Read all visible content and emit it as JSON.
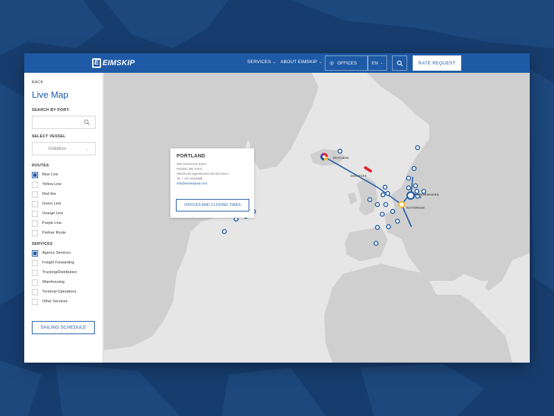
{
  "header": {
    "logo_text": "EIMSKIP",
    "logo_mark": "E",
    "nav": [
      {
        "label": "SERVICES"
      },
      {
        "label": "ABOUT EIMSKIP"
      }
    ],
    "offices_label": "OFFICES",
    "language": "EN",
    "rate_request_label": "RATE REQUEST"
  },
  "sidebar": {
    "back_label": "BACK",
    "title": "Live Map",
    "search_port_label": "SEARCH BY PORT:",
    "search_port_value": "",
    "select_vessel_label": "SELECT VESSEL",
    "selected_vessel": "Godafoss",
    "routes_label": "ROUTES",
    "routes": [
      {
        "label": "Blue Line",
        "checked": true
      },
      {
        "label": "Yellow Line",
        "checked": false
      },
      {
        "label": "Red line",
        "checked": false
      },
      {
        "label": "Green Line",
        "checked": false
      },
      {
        "label": "Orange Line",
        "checked": false
      },
      {
        "label": "Purple Line",
        "checked": false
      },
      {
        "label": "Partner Route",
        "checked": false
      }
    ],
    "services_label": "SERVICES",
    "services": [
      {
        "label": "Agency Services",
        "checked": true
      },
      {
        "label": "Freight Forwarding",
        "checked": false
      },
      {
        "label": "Trucking/Distribution",
        "checked": false
      },
      {
        "label": "Warehousing",
        "checked": false
      },
      {
        "label": "Terminal Operations",
        "checked": false
      },
      {
        "label": "Other Services",
        "checked": false
      }
    ],
    "sailing_schedule_label": "SAILING SCHEDULE"
  },
  "popup": {
    "title": "PORTLAND",
    "address_line1": "460 Commercial Street",
    "address_line2": "Portland, ME 04101",
    "address_line3": "Warehouse appointments and directions",
    "tel": "Tel. + 207-619-5888",
    "email": "info@eimskipusa.com",
    "button_label": "OFFICES AND CLOSING TIMES"
  },
  "map_labels": {
    "reykjavik": "REYKJAVIK",
    "godafoss": "GODAFOSS",
    "bremerhaven": "BREMERHAVEN",
    "rotterdam": "ROTTERDAM"
  },
  "colors": {
    "brand_blue": "#1f5aa6",
    "vessel_red": "#e0242f",
    "port_yellow": "#f5b82e",
    "background_navy": "#173d6e"
  },
  "icons": {
    "search": "search-icon",
    "location": "location-pin-icon",
    "chevron": "chevron-down-icon"
  }
}
